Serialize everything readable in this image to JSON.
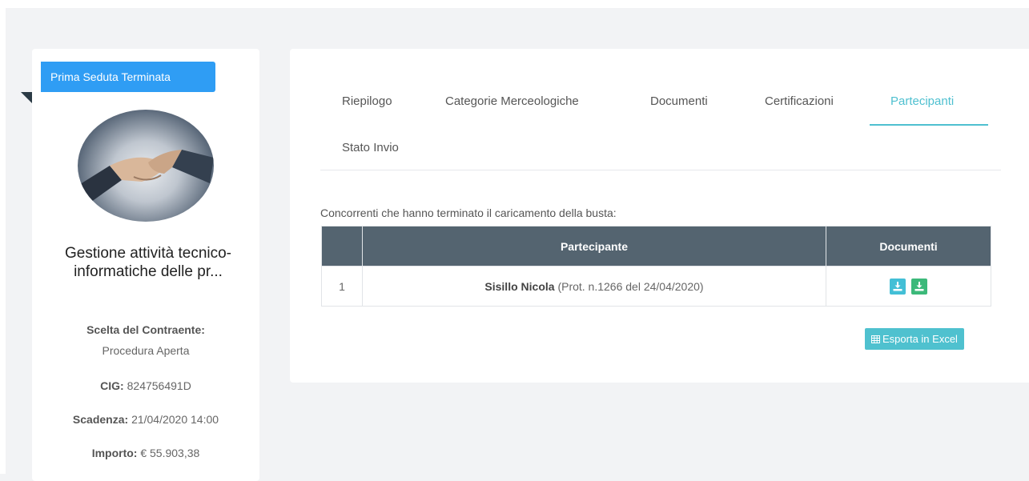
{
  "sidebar": {
    "status_badge": "Prima Seduta Terminata",
    "title": "Gestione attività tecnico-informatiche delle pr...",
    "scelta_label": "Scelta del Contraente:",
    "scelta_value": "Procedura Aperta",
    "cig_label": "CIG:",
    "cig_value": "824756491D",
    "scadenza_label": "Scadenza:",
    "scadenza_value": "21/04/2020 14:00",
    "importo_label": "Importo:",
    "importo_value": "€ 55.903,38"
  },
  "tabs": [
    {
      "label": "Riepilogo",
      "active": false
    },
    {
      "label": "Categorie Merceologiche",
      "active": false
    },
    {
      "label": "Documenti",
      "active": false
    },
    {
      "label": "Certificazioni",
      "active": false
    },
    {
      "label": "Partecipanti",
      "active": true
    },
    {
      "label": "Stato Invio",
      "active": false
    }
  ],
  "main": {
    "caption": "Concorrenti che hanno terminato il caricamento della busta:",
    "table": {
      "headers": [
        "",
        "Partecipante",
        "Documenti"
      ],
      "rows": [
        {
          "index": "1",
          "name": "Sisillo Nicola",
          "detail": "(Prot. n.1266 del 24/04/2020)"
        }
      ]
    },
    "export_label": "Esporta in Excel"
  },
  "colors": {
    "badge": "#2f9df4",
    "active_tab": "#4fc0d0",
    "table_header": "#546470",
    "download_blue": "#43bfd6",
    "download_green": "#3cb97a",
    "export_button": "#4fc1cf"
  }
}
